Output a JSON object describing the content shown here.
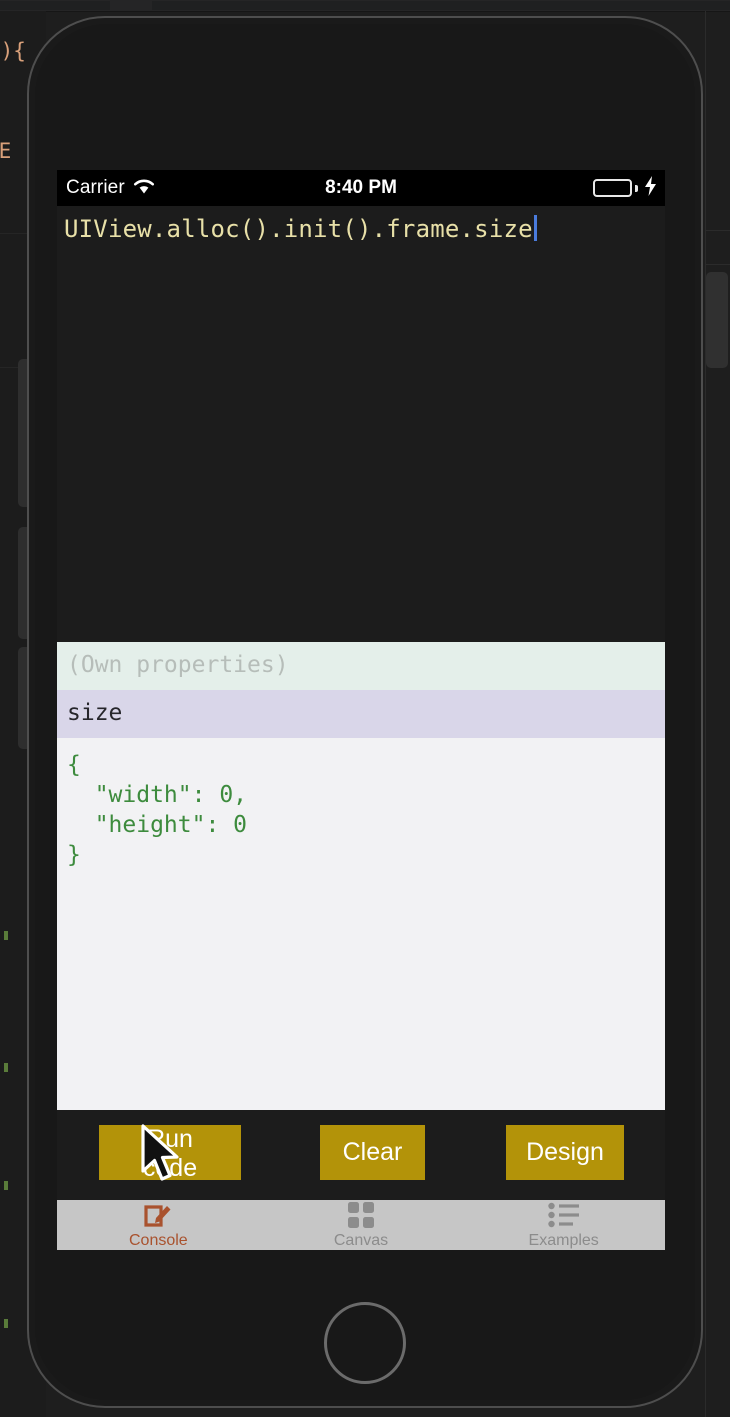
{
  "background_editor": {
    "visible_code_fragments": [
      "+){",
      ";",
      "nE"
    ],
    "description": "code-editor-behind-simulator"
  },
  "device": {
    "name": "iphone-simulator",
    "home_button": "home-button"
  },
  "status_bar": {
    "carrier": "Carrier",
    "wifi_icon": "wifi-icon",
    "time": "8:40 PM",
    "battery_icon": "battery-icon",
    "charging_icon": "lightning-bolt-icon",
    "battery_color": "#8ede5f"
  },
  "editor": {
    "code": "UIView.alloc().init().frame.size",
    "caret_color": "#4a7bdc",
    "text_color": "#e8e0a8"
  },
  "console": {
    "rows": [
      {
        "type": "header",
        "text": "(Own properties)"
      },
      {
        "type": "key",
        "text": "size"
      },
      {
        "type": "value",
        "text": "{\n  \"width\": 0,\n  \"height\": 0\n}"
      }
    ],
    "header_bg": "#e4efea",
    "key_bg": "#d9d6e9",
    "value_color": "#3d8b3d"
  },
  "buttons": {
    "accent": "#b39309",
    "run": "Run code",
    "clear": "Clear",
    "design": "Design"
  },
  "tab_bar": {
    "active_color": "#a9522e",
    "inactive_color": "#8c8c8c",
    "items": [
      {
        "label": "Console",
        "icon": "compose-icon",
        "active": true
      },
      {
        "label": "Canvas",
        "icon": "grid-icon",
        "active": false
      },
      {
        "label": "Examples",
        "icon": "bullet-list-icon",
        "active": false
      }
    ]
  },
  "cursor": {
    "icon": "mouse-pointer-icon"
  }
}
